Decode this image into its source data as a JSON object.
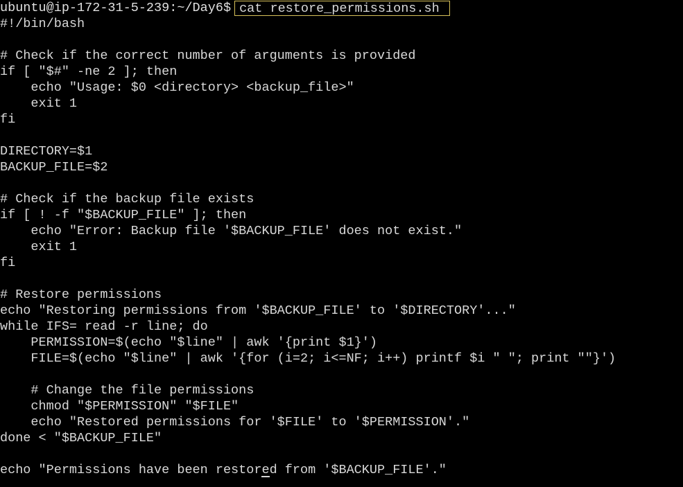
{
  "terminal": {
    "prompt": "ubuntu@ip-172-31-5-239:~/Day6$",
    "command": "cat restore_permissions.sh",
    "lines": [
      "#!/bin/bash",
      "",
      "# Check if the correct number of arguments is provided",
      "if [ \"$#\" -ne 2 ]; then",
      "    echo \"Usage: $0 <directory> <backup_file>\"",
      "    exit 1",
      "fi",
      "",
      "DIRECTORY=$1",
      "BACKUP_FILE=$2",
      "",
      "# Check if the backup file exists",
      "if [ ! -f \"$BACKUP_FILE\" ]; then",
      "    echo \"Error: Backup file '$BACKUP_FILE' does not exist.\"",
      "    exit 1",
      "fi",
      "",
      "# Restore permissions",
      "echo \"Restoring permissions from '$BACKUP_FILE' to '$DIRECTORY'...\"",
      "while IFS= read -r line; do",
      "    PERMISSION=$(echo \"$line\" | awk '{print $1}')",
      "    FILE=$(echo \"$line\" | awk '{for (i=2; i<=NF; i++) printf $i \" \"; print \"\"}')",
      "",
      "    # Change the file permissions",
      "    chmod \"$PERMISSION\" \"$FILE\"",
      "    echo \"Restored permissions for '$FILE' to '$PERMISSION'.\"",
      "done < \"$BACKUP_FILE\"",
      "",
      "echo \"Permissions have been restored from '$BACKUP_FILE'.\""
    ]
  }
}
